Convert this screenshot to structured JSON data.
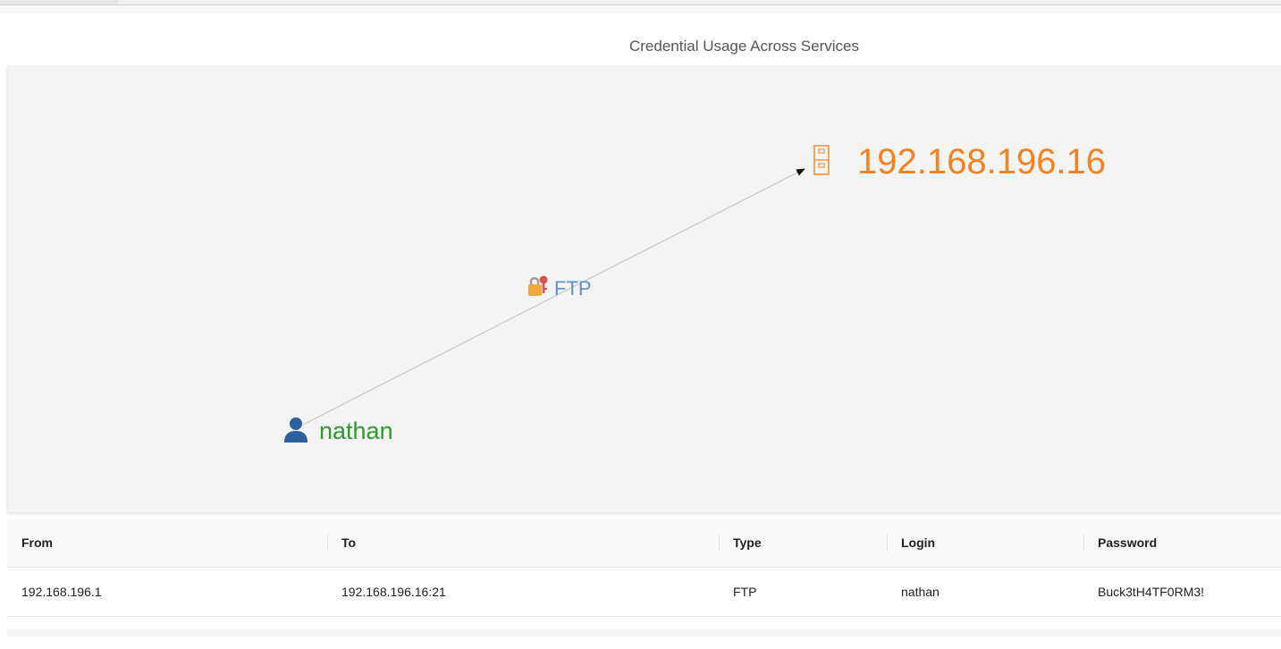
{
  "graph": {
    "title": "Credential Usage Across Services",
    "nodes": {
      "server": {
        "label": "192.168.196.16",
        "icon": "server-icon",
        "color": "#f5821f"
      },
      "user": {
        "label": "nathan",
        "icon": "user-icon",
        "color": "#2e9b2e"
      }
    },
    "edge": {
      "label": "FTP",
      "icon": "lock-key-icon",
      "color": "#5f93c6"
    }
  },
  "table": {
    "headers": {
      "from": "From",
      "to": "To",
      "type": "Type",
      "login": "Login",
      "password": "Password"
    },
    "rows": [
      {
        "from": "192.168.196.1",
        "to": "192.168.196.16:21",
        "type": "FTP",
        "login": "nathan",
        "password": "Buck3tH4TF0RM3!"
      }
    ]
  }
}
